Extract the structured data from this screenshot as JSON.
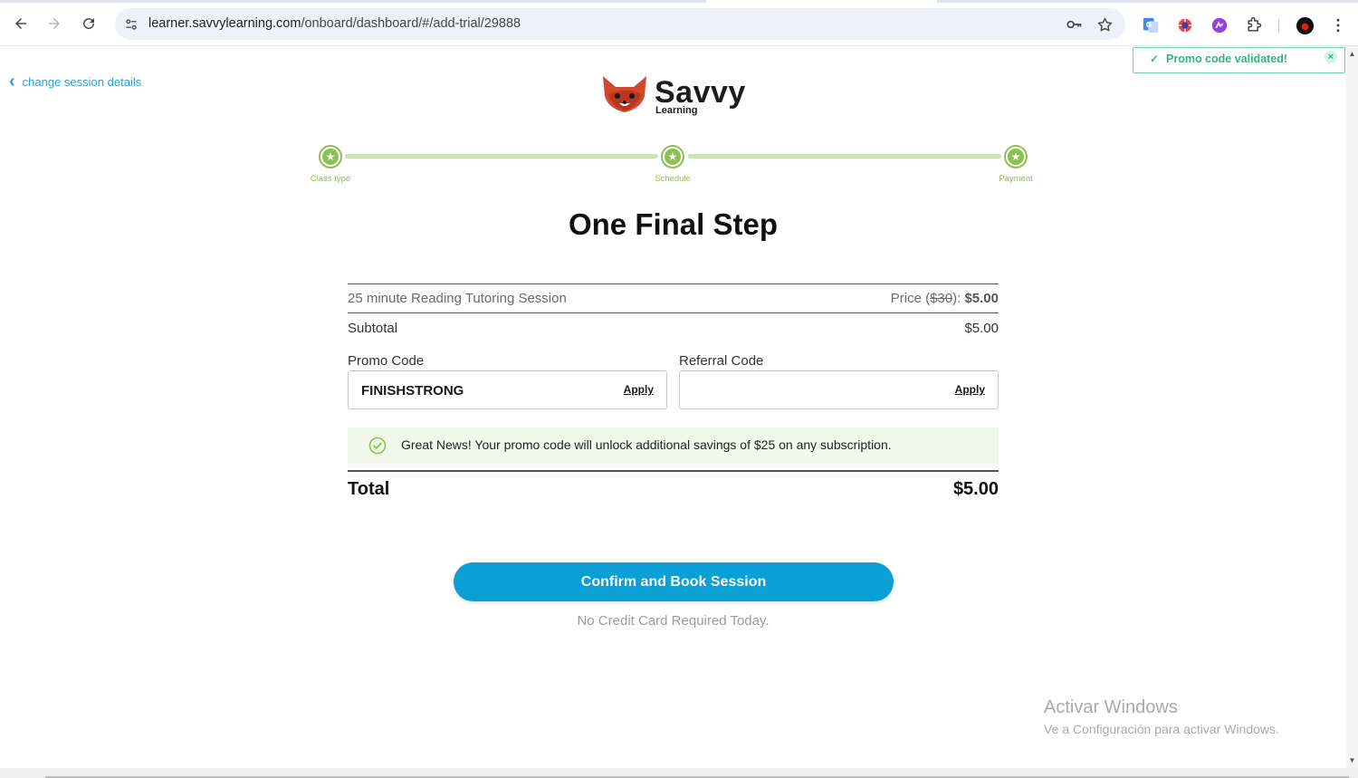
{
  "browser": {
    "url_host": "learner.savvylearning.com",
    "url_path": "/onboard/dashboard/#/add-trial/29888"
  },
  "page": {
    "back_link": "change session details",
    "logo": {
      "brand": "Savvy",
      "sub": "Learning"
    },
    "toast": {
      "message": "Promo code validated!"
    },
    "steps": [
      {
        "label": "Class type",
        "state": "complete"
      },
      {
        "label": "Schedule",
        "state": "complete"
      },
      {
        "label": "Payment",
        "state": "complete"
      }
    ],
    "title": "One Final Step",
    "line_item": {
      "name": "25 minute Reading Tutoring Session",
      "price_prefix": "Price (",
      "original_price": "$30",
      "price_mid": "): ",
      "price": "$5.00"
    },
    "subtotal": {
      "label": "Subtotal",
      "value": "$5.00"
    },
    "promo": {
      "label": "Promo Code",
      "value": "FINISHSTRONG",
      "apply": "Apply"
    },
    "referral": {
      "label": "Referral Code",
      "value": "",
      "apply": "Apply"
    },
    "notice": "Great News! Your promo code will unlock additional savings of $25 on any subscription.",
    "total": {
      "label": "Total",
      "value": "$5.00"
    },
    "cta": "Confirm and Book Session",
    "cta_note": "No Credit Card Required Today."
  },
  "watermark": {
    "title": "Activar Windows",
    "subtitle": "Ve a Configuración para activar Windows."
  },
  "colors": {
    "accent": "#0aa0d6",
    "success": "#8cc152",
    "toast": "#36b37e",
    "link": "#2b9fd6"
  }
}
